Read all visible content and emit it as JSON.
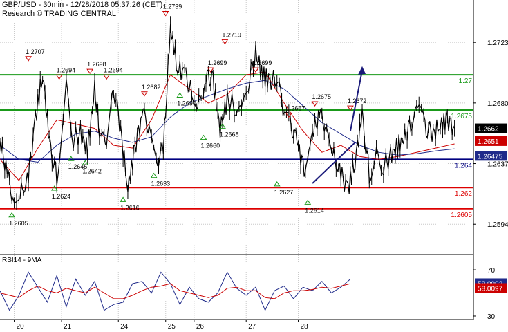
{
  "header": {
    "line1": "GBP/USD - 30min - 12/28/2018 05:37:26 (CET)",
    "line2": "Research © TRADING CENTRAL"
  },
  "colors": {
    "price": "#000000",
    "ma_fast": "#cc0000",
    "ma_slow": "#1f2a8a",
    "resistance": "#1a9a1a",
    "pivot": "#000080",
    "support": "#dd0000",
    "projection": "#1a1a7a",
    "grid": "#c8c8c8",
    "current_badge": "#000000",
    "fast_badge": "#cc0000",
    "slow_badge": "#1f2a8a"
  },
  "chart_data": [
    {
      "type": "line",
      "title": "",
      "symbol": "GBP/USD",
      "timeframe": "30min",
      "x_axis": {
        "tick_labels": [
          "20",
          "21",
          "24",
          "25",
          "26",
          "27",
          "28"
        ],
        "range": [
          0,
          100
        ]
      },
      "y_axis": {
        "position": "right",
        "tick_labels": [
          "1.2723",
          "1.2680",
          "1.2637",
          "1.2594"
        ],
        "range": [
          1.2574,
          1.2753
        ]
      },
      "grid": true,
      "current_price": "1.2662",
      "ma_badges": {
        "fast": "1.2651",
        "slow": "1.26475"
      },
      "series": [
        {
          "role": "price",
          "x": [
            0,
            1.5,
            3,
            4.5,
            6,
            7.5,
            9,
            10.5,
            12,
            14,
            15.5,
            17,
            18.5,
            20,
            21,
            22.5,
            24,
            25.5,
            27,
            28.5,
            30,
            31.5,
            33,
            34.5,
            36,
            37.5,
            39,
            40.5,
            42,
            43.5,
            45,
            46.5,
            48,
            49.5,
            51,
            52.5,
            54,
            55.5,
            57,
            58.5,
            60,
            61.5,
            63,
            64.5,
            66,
            67.5,
            69,
            70.5,
            72,
            73.5,
            75,
            76.5,
            78,
            79.5,
            81,
            82.5,
            84,
            85.5,
            87,
            88.5,
            90,
            91.5,
            93,
            94.5,
            96
          ],
          "values": [
            1.2654,
            1.2628,
            1.2612,
            1.262,
            1.2628,
            1.2668,
            1.2702,
            1.265,
            1.2628,
            1.269,
            1.2655,
            1.2658,
            1.2647,
            1.269,
            1.2662,
            1.2644,
            1.2691,
            1.266,
            1.262,
            1.2648,
            1.2672,
            1.2664,
            1.264,
            1.2646,
            1.2733,
            1.2705,
            1.27,
            1.269,
            1.268,
            1.27,
            1.2695,
            1.2662,
            1.2682,
            1.2678,
            1.267,
            1.2695,
            1.2715,
            1.27,
            1.2695,
            1.2698,
            1.267,
            1.2665,
            1.2648,
            1.2632,
            1.266,
            1.267,
            1.2665,
            1.2645,
            1.263,
            1.2618,
            1.264,
            1.267,
            1.263,
            1.2642,
            1.2636,
            1.2642,
            1.265,
            1.2655,
            1.2668,
            1.2673,
            1.2662,
            1.2658,
            1.2665,
            1.2668,
            1.2662
          ]
        },
        {
          "role": "ma_fast",
          "x": [
            0,
            4,
            8,
            12,
            16,
            20,
            24,
            28,
            32,
            36,
            40,
            44,
            48,
            52,
            56,
            60,
            64,
            68,
            72,
            76,
            80,
            84,
            88,
            92,
            96
          ],
          "values": [
            1.264,
            1.2625,
            1.2648,
            1.2668,
            1.2665,
            1.2662,
            1.265,
            1.2648,
            1.2668,
            1.27,
            1.269,
            1.268,
            1.2686,
            1.27,
            1.2702,
            1.268,
            1.266,
            1.2645,
            1.265,
            1.2642,
            1.264,
            1.2642,
            1.2645,
            1.2648,
            1.2651
          ]
        },
        {
          "role": "ma_slow",
          "x": [
            0,
            4,
            8,
            12,
            16,
            20,
            24,
            28,
            32,
            36,
            40,
            44,
            48,
            52,
            56,
            60,
            64,
            68,
            72,
            76,
            80,
            84,
            88,
            92,
            96
          ],
          "values": [
            1.265,
            1.264,
            1.2638,
            1.265,
            1.2658,
            1.266,
            1.2655,
            1.2652,
            1.2656,
            1.267,
            1.268,
            1.2685,
            1.269,
            1.2694,
            1.2696,
            1.269,
            1.2678,
            1.2666,
            1.2658,
            1.265,
            1.2645,
            1.2643,
            1.2644,
            1.2646,
            1.26475
          ]
        }
      ],
      "levels": [
        {
          "role": "resistance",
          "value": 1.27,
          "label": "1.27"
        },
        {
          "role": "resistance",
          "value": 1.2675,
          "label": "1.2675"
        },
        {
          "role": "pivot",
          "value": 1.264,
          "label": "1.264"
        },
        {
          "role": "support",
          "value": 1.262,
          "label": "1.262"
        },
        {
          "role": "support",
          "value": 1.2605,
          "label": "1.2605"
        }
      ],
      "annotations": [
        {
          "kind": "high",
          "x": 6,
          "value": 1.2707,
          "label": "1.2707"
        },
        {
          "kind": "high",
          "x": 12.5,
          "value": 1.2694,
          "label": "1.2694"
        },
        {
          "kind": "high",
          "x": 19,
          "value": 1.2698,
          "label": "1.2698"
        },
        {
          "kind": "high",
          "x": 22.5,
          "value": 1.2694,
          "label": "1.2694"
        },
        {
          "kind": "high",
          "x": 30.5,
          "value": 1.2682,
          "label": "1.2682"
        },
        {
          "kind": "high",
          "x": 35,
          "value": 1.2739,
          "label": "1.2739"
        },
        {
          "kind": "high",
          "x": 44.5,
          "value": 1.2699,
          "label": "1.2699"
        },
        {
          "kind": "high",
          "x": 47.5,
          "value": 1.2719,
          "label": "1.2719"
        },
        {
          "kind": "high",
          "x": 54,
          "value": 1.2699,
          "label": "1.2699"
        },
        {
          "kind": "high",
          "x": 61,
          "value": 1.2667,
          "label": "1.2667"
        },
        {
          "kind": "high",
          "x": 66.5,
          "value": 1.2675,
          "label": "1.2675"
        },
        {
          "kind": "high",
          "x": 74,
          "value": 1.2672,
          "label": "1.2672"
        },
        {
          "kind": "low",
          "x": 2.5,
          "value": 1.2605,
          "label": "1.2605"
        },
        {
          "kind": "low",
          "x": 11.5,
          "value": 1.2624,
          "label": "1.2624"
        },
        {
          "kind": "low",
          "x": 15,
          "value": 1.2645,
          "label": "1.2645"
        },
        {
          "kind": "low",
          "x": 18,
          "value": 1.2642,
          "label": "1.2642"
        },
        {
          "kind": "low",
          "x": 26,
          "value": 1.2616,
          "label": "1.2616"
        },
        {
          "kind": "low",
          "x": 32.5,
          "value": 1.2633,
          "label": "1.2633"
        },
        {
          "kind": "low",
          "x": 38,
          "value": 1.269,
          "label": "1.2690"
        },
        {
          "kind": "low",
          "x": 43,
          "value": 1.266,
          "label": "1.2660"
        },
        {
          "kind": "low",
          "x": 47,
          "value": 1.2668,
          "label": "1.2668"
        },
        {
          "kind": "low",
          "x": 58.5,
          "value": 1.2627,
          "label": "1.2627"
        },
        {
          "kind": "low",
          "x": 65,
          "value": 1.2614,
          "label": "1.2614"
        }
      ],
      "projection": {
        "trendline": {
          "x": [
            66,
            75
          ],
          "values": [
            1.2623,
            1.2652
          ]
        },
        "arrow": {
          "x": [
            74,
            76.5
          ],
          "values": [
            1.266,
            1.2706
          ]
        }
      }
    },
    {
      "type": "line",
      "title": "RSI14 - 9MA",
      "x_axis": {
        "range": [
          0,
          100
        ]
      },
      "y_axis": {
        "position": "right",
        "tick_labels": [
          "70",
          "30"
        ],
        "range": [
          27,
          82
        ]
      },
      "grid": true,
      "rsi_badges": {
        "rsi": "58.0902",
        "ma": "58.0097"
      },
      "series": [
        {
          "role": "rsi",
          "x": [
            0,
            2,
            4,
            6,
            8,
            10,
            12,
            14,
            16,
            18,
            20,
            22,
            24,
            26,
            28,
            30,
            32,
            34,
            36,
            38,
            40,
            42,
            44,
            46,
            48,
            50,
            52,
            54,
            56,
            58,
            60,
            62,
            64,
            66,
            68,
            70,
            72,
            74
          ],
          "values": [
            52,
            35,
            48,
            68,
            55,
            42,
            65,
            38,
            62,
            48,
            60,
            35,
            40,
            42,
            58,
            60,
            50,
            68,
            58,
            40,
            55,
            45,
            42,
            50,
            68,
            54,
            48,
            55,
            35,
            52,
            56,
            45,
            55,
            52,
            60,
            50,
            55,
            62
          ]
        },
        {
          "role": "rsi_ma",
          "x": [
            0,
            2,
            4,
            6,
            8,
            10,
            12,
            14,
            16,
            18,
            20,
            22,
            24,
            26,
            28,
            30,
            32,
            34,
            36,
            38,
            40,
            42,
            44,
            46,
            48,
            50,
            52,
            54,
            56,
            58,
            60,
            62,
            64,
            66,
            68,
            70,
            72,
            74
          ],
          "values": [
            50,
            48,
            46,
            52,
            56,
            52,
            50,
            54,
            52,
            50,
            55,
            50,
            45,
            45,
            48,
            52,
            55,
            56,
            58,
            52,
            50,
            48,
            46,
            48,
            54,
            55,
            52,
            52,
            46,
            45,
            50,
            52,
            52,
            53,
            55,
            54,
            56,
            58
          ]
        }
      ]
    }
  ]
}
